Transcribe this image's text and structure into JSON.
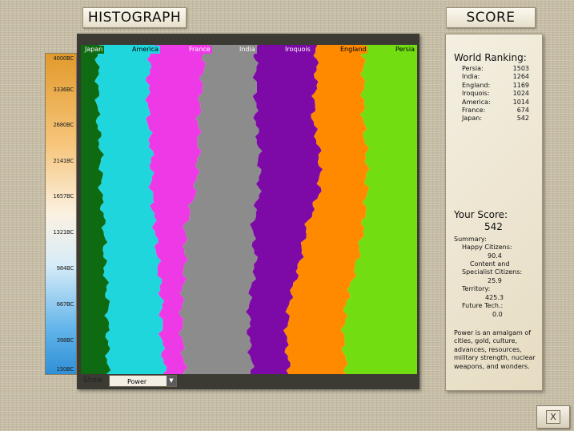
{
  "header": {
    "histograph_title": "HISTOGRAPH",
    "score_title": "SCORE"
  },
  "icons": {
    "close": "close-x-icon",
    "dropdown": "dropdown-arrow-icon"
  },
  "timeline": {
    "labels": [
      "4000BC",
      "3336BC",
      "2680BC",
      "2141BC",
      "1657BC",
      "1321BC",
      "984BC",
      "667BC",
      "398BC",
      "150BC"
    ]
  },
  "legend": [
    {
      "name": "Japan",
      "color": "#0e6b12"
    },
    {
      "name": "America",
      "color": "#1fd6dc"
    },
    {
      "name": "France",
      "color": "#ee3ae6"
    },
    {
      "name": "India",
      "color": "#8c8c8c"
    },
    {
      "name": "Iroquois",
      "color": "#7d0aa6"
    },
    {
      "name": "England",
      "color": "#ff8a00"
    },
    {
      "name": "Persia",
      "color": "#72dd10"
    }
  ],
  "chart_data": {
    "type": "area",
    "stacked": true,
    "normalized": true,
    "metric": "Power",
    "series": [
      {
        "name": "Japan",
        "color": "#0e6b12",
        "values": [
          0.05,
          0.05,
          0.05,
          0.06,
          0.06,
          0.07,
          0.07,
          0.08,
          0.08,
          0.08
        ]
      },
      {
        "name": "America",
        "color": "#1fd6dc",
        "values": [
          0.16,
          0.15,
          0.15,
          0.15,
          0.15,
          0.15,
          0.16,
          0.16,
          0.16,
          0.17
        ]
      },
      {
        "name": "France",
        "color": "#ee3ae6",
        "values": [
          0.16,
          0.16,
          0.15,
          0.14,
          0.13,
          0.09,
          0.08,
          0.06,
          0.06,
          0.06
        ]
      },
      {
        "name": "India",
        "color": "#8c8c8c",
        "values": [
          0.15,
          0.16,
          0.17,
          0.18,
          0.19,
          0.2,
          0.21,
          0.2,
          0.2,
          0.2
        ]
      },
      {
        "name": "Iroquois",
        "color": "#7d0aa6",
        "values": [
          0.18,
          0.18,
          0.17,
          0.18,
          0.18,
          0.16,
          0.13,
          0.12,
          0.11,
          0.11
        ]
      },
      {
        "name": "England",
        "color": "#ff8a00",
        "values": [
          0.14,
          0.14,
          0.15,
          0.14,
          0.14,
          0.17,
          0.17,
          0.17,
          0.17,
          0.17
        ]
      },
      {
        "name": "Persia",
        "color": "#72dd10",
        "values": [
          0.16,
          0.16,
          0.16,
          0.15,
          0.15,
          0.16,
          0.18,
          0.21,
          0.22,
          0.21
        ]
      }
    ]
  },
  "controls": {
    "show_label": "Show",
    "show_value": "Power"
  },
  "ranking": {
    "heading": "World Ranking:",
    "rows": [
      {
        "name": "Persia:",
        "value": "1503"
      },
      {
        "name": "India:",
        "value": "1264"
      },
      {
        "name": "England:",
        "value": "1169"
      },
      {
        "name": "Iroquois:",
        "value": "1024"
      },
      {
        "name": "America:",
        "value": "1014"
      },
      {
        "name": "France:",
        "value": "674"
      },
      {
        "name": "Japan:",
        "value": "542"
      }
    ]
  },
  "your_score": {
    "heading": "Your Score:",
    "value": "542",
    "summary_label": "Summary:",
    "happy_label": "Happy Citizens:",
    "happy_value": "90.4",
    "content_label_1": "Content and",
    "content_label_2": "Specialist Citizens:",
    "content_value": "25.9",
    "territory_label": "Territory:",
    "territory_value": "425.3",
    "future_label": "Future Tech.:",
    "future_value": "0.0"
  },
  "description": "Power is an amalgam of cities, gold, culture, advances, resources, military strength, nuclear weapons, and wonders."
}
